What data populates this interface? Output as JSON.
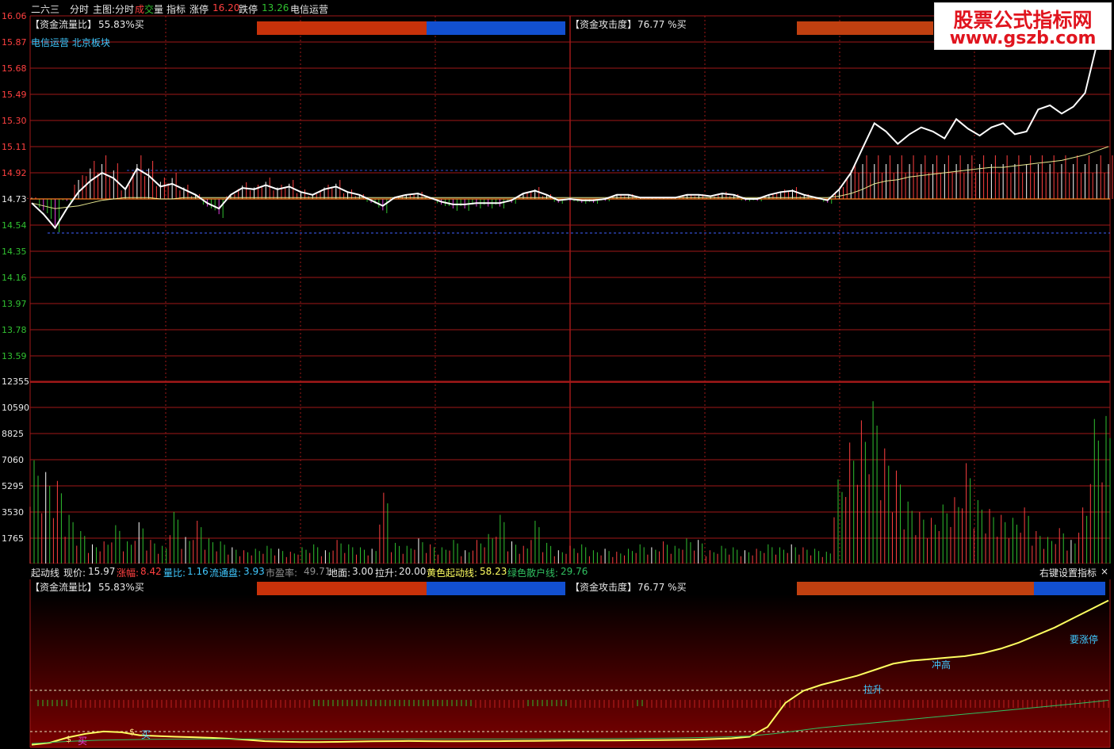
{
  "topbar": {
    "stock_name": "二六三",
    "view": "分时",
    "main_chart": "主图:分时",
    "volume_prefix": "成",
    "volume_mid": "交",
    "volume_suffix": "量",
    "indicator": "指标",
    "limit_up_label": "涨停",
    "limit_up_value": "16.20",
    "limit_down_label": "跌停",
    "limit_down_value": "13.26",
    "sector": "电信运营"
  },
  "price_panel": {
    "fund_ratio_label": "【资金流量比】",
    "fund_ratio_value": "55.83%买",
    "attack_label": "【资金攻击度】",
    "attack_value": "76.77 %买",
    "sector_text": "电信运营 北京板块",
    "y_ticks": [
      "16.06",
      "15.87",
      "15.68",
      "15.49",
      "15.30",
      "15.11",
      "14.92",
      "14.73",
      "14.54",
      "14.35",
      "14.16",
      "13.97",
      "13.78",
      "13.59"
    ]
  },
  "volume_panel": {
    "y_ticks": [
      "12355",
      "10590",
      "8825",
      "7060",
      "5295",
      "3530",
      "1765"
    ]
  },
  "status": {
    "indicator_name": "起动线",
    "price_label": "现价:",
    "price_value": "15.97",
    "change_label": "涨幅:",
    "change_value": "8.42",
    "vol_ratio_label": "量比:",
    "vol_ratio_value": "1.16",
    "float_label": "流通盘:",
    "float_value": "3.93",
    "pe_label": "市盈率:",
    "pe_value": "49.71",
    "ground_label": "地面:",
    "ground_value": "3.00",
    "pull_label": "拉升:",
    "pull_value": "20.00",
    "yellow_label": "黄色起动线:",
    "yellow_value": "58.23",
    "green_label": "绿色散户线:",
    "green_value": "29.76",
    "right_menu": "右键设置指标",
    "close_glyph": "×"
  },
  "indicator_panel": {
    "fund_ratio_label": "【资金流量比】",
    "fund_ratio_value": "55.83%买",
    "attack_label": "【资金攻击度】",
    "attack_value": "76.77 %买",
    "labels": {
      "buy1": "买",
      "buy2": "买",
      "pull": "拉升",
      "high": "冲高",
      "limit": "要涨停"
    }
  },
  "watermark": {
    "line1": "股票公式指标网",
    "line2": "www.gszb.com"
  },
  "colors": {
    "grid": "#a01818",
    "price_line": "#ffffff",
    "avg_line": "#e8e890",
    "up": "#ff4040",
    "down": "#30c030",
    "yellow": "#ffff60",
    "green_line": "#30c060",
    "bar_red": "#c8320a",
    "bar_blue": "#1250d0"
  },
  "chart_data": {
    "type": "line",
    "intraday_price": [
      14.7,
      14.62,
      14.52,
      14.66,
      14.78,
      14.86,
      14.92,
      14.88,
      14.8,
      14.95,
      14.9,
      14.82,
      14.84,
      14.8,
      14.76,
      14.7,
      14.66,
      14.76,
      14.81,
      14.8,
      14.83,
      14.8,
      14.82,
      14.78,
      14.76,
      14.8,
      14.82,
      14.78,
      14.76,
      14.72,
      14.68,
      14.74,
      14.76,
      14.77,
      14.74,
      14.71,
      14.69,
      14.69,
      14.7,
      14.7,
      14.7,
      14.72,
      14.77,
      14.79,
      14.76,
      14.72,
      14.73,
      14.72,
      14.72,
      14.73,
      14.76,
      14.76,
      14.74,
      14.74,
      14.74,
      14.74,
      14.76,
      14.76,
      14.75,
      14.77,
      14.76,
      14.73,
      14.73,
      14.76,
      14.78,
      14.79,
      14.76,
      14.74,
      14.72,
      14.8,
      14.92,
      15.1,
      15.28,
      15.22,
      15.13,
      15.2,
      15.25,
      15.22,
      15.17,
      15.31,
      15.24,
      15.19,
      15.25,
      15.28,
      15.2,
      15.22,
      15.38,
      15.41,
      15.35,
      15.4,
      15.5,
      15.85,
      16.1
    ],
    "avg_price": [
      14.7,
      14.68,
      14.66,
      14.67,
      14.68,
      14.7,
      14.72,
      14.73,
      14.74,
      14.74,
      14.74,
      14.73,
      14.73,
      14.74,
      14.74,
      14.74,
      14.74,
      14.74,
      14.74,
      14.74,
      14.74,
      14.74,
      14.74,
      14.74,
      14.74,
      14.74,
      14.74,
      14.74,
      14.74,
      14.74,
      14.74,
      14.74,
      14.74,
      14.74,
      14.74,
      14.74,
      14.74,
      14.74,
      14.74,
      14.74,
      14.74,
      14.74,
      14.74,
      14.74,
      14.74,
      14.74,
      14.74,
      14.74,
      14.74,
      14.74,
      14.74,
      14.74,
      14.74,
      14.74,
      14.74,
      14.74,
      14.74,
      14.74,
      14.74,
      14.74,
      14.74,
      14.74,
      14.74,
      14.74,
      14.74,
      14.74,
      14.74,
      14.74,
      14.74,
      14.75,
      14.77,
      14.8,
      14.84,
      14.86,
      14.87,
      14.89,
      14.9,
      14.91,
      14.92,
      14.93,
      14.94,
      14.95,
      14.96,
      14.96,
      14.97,
      14.98,
      14.99,
      15.0,
      15.01,
      15.03,
      15.05,
      15.08,
      15.11
    ],
    "ylim": [
      13.5,
      16.1
    ],
    "volume": [
      7000,
      6200,
      5600,
      3300,
      2200,
      1300,
      1500,
      2600,
      1500,
      2800,
      1600,
      1200,
      3500,
      1800,
      2900,
      1700,
      1500,
      1100,
      900,
      1000,
      1200,
      1000,
      800,
      1100,
      1300,
      900,
      1600,
      1300,
      1100,
      1000,
      4800,
      1400,
      1200,
      1700,
      1300,
      1100,
      1600,
      900,
      1600,
      2000,
      3300,
      1500,
      1200,
      2900,
      1400,
      900,
      1200,
      1300,
      900,
      1000,
      800,
      1000,
      1300,
      1100,
      1500,
      1200,
      1700,
      1600,
      900,
      1200,
      1100,
      900,
      1000,
      1300,
      1100,
      1300,
      1100,
      1000,
      800,
      5700,
      8200,
      9700,
      11000,
      7800,
      6300,
      4200,
      3500,
      3100,
      4000,
      4500,
      6800,
      4300,
      3700,
      3300,
      3100,
      3800,
      2200,
      1800,
      2400,
      1600,
      3800,
      9800,
      10000
    ],
    "volume_ylim": [
      0,
      12355
    ],
    "starter_line": [
      0.2,
      1.5,
      5,
      7.5,
      9,
      8.5,
      6.5,
      6,
      5.5,
      5.2,
      4.8,
      4.2,
      3.5,
      2.6,
      2.2,
      2.0,
      2.0,
      2.1,
      2.3,
      2.5,
      2.6,
      2.7,
      2.6,
      2.5,
      2.5,
      2.6,
      2.6,
      2.7,
      2.8,
      2.9,
      3.0,
      3.0,
      3.0,
      3.1,
      3.2,
      3.3,
      3.4,
      3.6,
      4.0,
      4.5,
      5.5,
      12,
      28,
      36,
      40,
      43,
      46,
      50,
      54,
      56,
      57,
      58,
      59,
      61,
      64,
      68,
      73,
      78,
      84,
      90,
      96
    ],
    "retail_line": [
      1,
      2,
      2.8,
      3.3,
      3.6,
      3.8,
      3.9,
      4.0,
      4.0,
      4.0,
      4.0,
      4.0,
      4.0,
      4.0,
      4.0,
      4.0,
      4.0,
      4.0,
      4.0,
      4.0,
      4.0,
      4.0,
      4.0,
      4.1,
      4.2,
      4.3,
      4.5,
      4.7,
      5.0,
      5.4,
      6.0,
      7.5,
      9.5,
      11.5,
      13,
      14.5,
      16,
      17.5,
      19,
      20.5,
      22,
      23.5,
      25,
      26.5,
      28,
      29.76
    ],
    "indicator_ylim": [
      0,
      100
    ]
  }
}
